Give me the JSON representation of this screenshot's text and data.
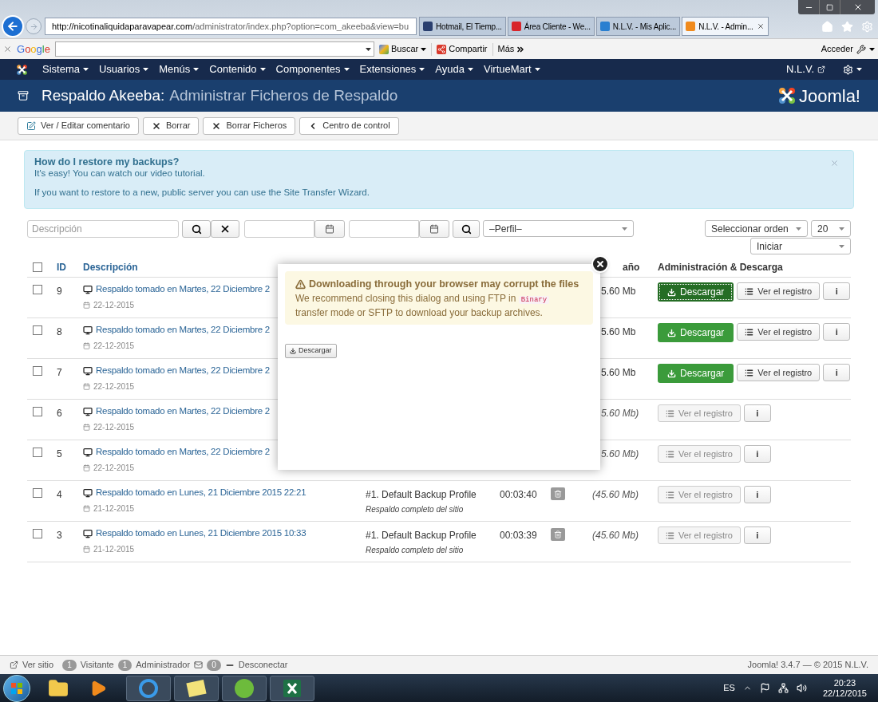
{
  "browser": {
    "address_host": "http://nicotinaliquidaparavapear.com",
    "address_path": "/administrator/index.php?option=com_akeeba&view=bu",
    "tabs": [
      {
        "label": "Hotmail, El Tiemp...",
        "selected": false,
        "color": "#2a3f6f"
      },
      {
        "label": "Área Cliente - We...",
        "selected": false,
        "color": "#d8252b"
      },
      {
        "label": "N.L.V. - Mis Aplic...",
        "selected": false,
        "color": "#2a7fd0"
      },
      {
        "label": "N.L.V. - Admin...",
        "selected": true,
        "color": "#f08a1c"
      }
    ]
  },
  "google_bar": {
    "logo": "Google",
    "search_button": "Buscar",
    "share_button": "Compartir",
    "more_button": "Más",
    "sign_in": "Acceder"
  },
  "nav": {
    "items": [
      {
        "label": "Sistema"
      },
      {
        "label": "Usuarios"
      },
      {
        "label": "Menús"
      },
      {
        "label": "Contenido"
      },
      {
        "label": "Componentes"
      },
      {
        "label": "Extensiones"
      },
      {
        "label": "Ayuda"
      },
      {
        "label": "VirtueMart"
      }
    ],
    "user": "N.L.V."
  },
  "header": {
    "title": "Respaldo Akeeba:",
    "subtitle": "Administrar Ficheros de Respaldo",
    "logo": "Joomla!"
  },
  "actions": [
    {
      "label": "Ver / Editar comentario",
      "kind": "edit"
    },
    {
      "label": "Borrar",
      "kind": "delete"
    },
    {
      "label": "Borrar Ficheros",
      "kind": "delete"
    },
    {
      "label": "Centro de control",
      "kind": "back"
    }
  ],
  "alert": {
    "title": "How do I restore my backups?",
    "text": "It's easy! You can watch our video tutorial.",
    "wizard_text": "If you want to restore to a new, public server you can use the Site Transfer Wizard."
  },
  "filters": {
    "description_placeholder": "Descripción",
    "profile": "–Perfil–",
    "order": "Seleccionar orden",
    "limit": "20",
    "direction": "Iniciar"
  },
  "table": {
    "all_checked": false,
    "columns": [
      "ID",
      "Descripción",
      "año",
      "Administración & Descarga"
    ],
    "rows": [
      {
        "id": "9",
        "checked": false,
        "kind": "available",
        "description": "Respaldo tomado en Martes, 22 Diciembre 2",
        "date": "22-12-2015",
        "size": "5.60 Mb",
        "download": "Descargar",
        "download_focused": true,
        "log": "Ver el registro",
        "info": "i"
      },
      {
        "id": "8",
        "checked": false,
        "kind": "available",
        "description": "Respaldo tomado en Martes, 22 Diciembre 2",
        "date": "22-12-2015",
        "size": "5.60 Mb",
        "download": "Descargar",
        "download_focused": false,
        "log": "Ver el registro",
        "info": "i"
      },
      {
        "id": "7",
        "checked": false,
        "kind": "available",
        "description": "Respaldo tomado en Martes, 22 Diciembre 2",
        "date": "22-12-2015",
        "size": "5.60 Mb",
        "download": "Descargar",
        "download_focused": false,
        "log": "Ver el registro",
        "info": "i"
      },
      {
        "id": "6",
        "checked": false,
        "kind": "obsolete",
        "description": "Respaldo tomado en Martes, 22 Diciembre 2",
        "date": "22-12-2015",
        "size": "5.60 Mb)",
        "log": "Ver el registro",
        "info": "i"
      },
      {
        "id": "5",
        "checked": false,
        "kind": "obsolete",
        "description": "Respaldo tomado en Martes, 22 Diciembre 2",
        "date": "22-12-2015",
        "size": "5.60 Mb)",
        "log": "Ver el registro",
        "info": "i"
      },
      {
        "id": "4",
        "checked": false,
        "kind": "obsolete",
        "description": "Respaldo tomado en Lunes, 21 Diciembre 2015 22:21",
        "date": "21-12-2015",
        "profile": "#1. Default Backup Profile",
        "profile_note": "Respaldo completo del sitio",
        "duration": "00:03:40",
        "size": "(45.60 Mb)",
        "log": "Ver el registro",
        "info": "i"
      },
      {
        "id": "3",
        "checked": false,
        "kind": "obsolete",
        "description": "Respaldo tomado en Lunes, 21 Diciembre 2015 10:33",
        "date": "21-12-2015",
        "profile": "#1. Default Backup Profile",
        "profile_note": "Respaldo completo del sitio",
        "duration": "00:03:39",
        "size": "(45.60 Mb)",
        "log": "Ver el registro",
        "info": "i"
      }
    ]
  },
  "modal": {
    "warning_title": "Downloading through your browser may corrupt the files",
    "text_before": "We recommend closing this dialog and using FTP in",
    "code": "Binary",
    "text_after": "transfer mode or SFTP to download your backup archives.",
    "download": "Descargar"
  },
  "status_bar": {
    "view_site": "Ver sitio",
    "visitors_count": "1",
    "visitors": "Visitante",
    "admins_count": "1",
    "admins": "Administrador",
    "messages_count": "0",
    "logout": "Desconectar",
    "version": "Joomla! 3.4.7 — © 2015 N.L.V."
  },
  "taskbar": {
    "language": "ES",
    "time": "20:23",
    "date": "22/12/2015"
  }
}
